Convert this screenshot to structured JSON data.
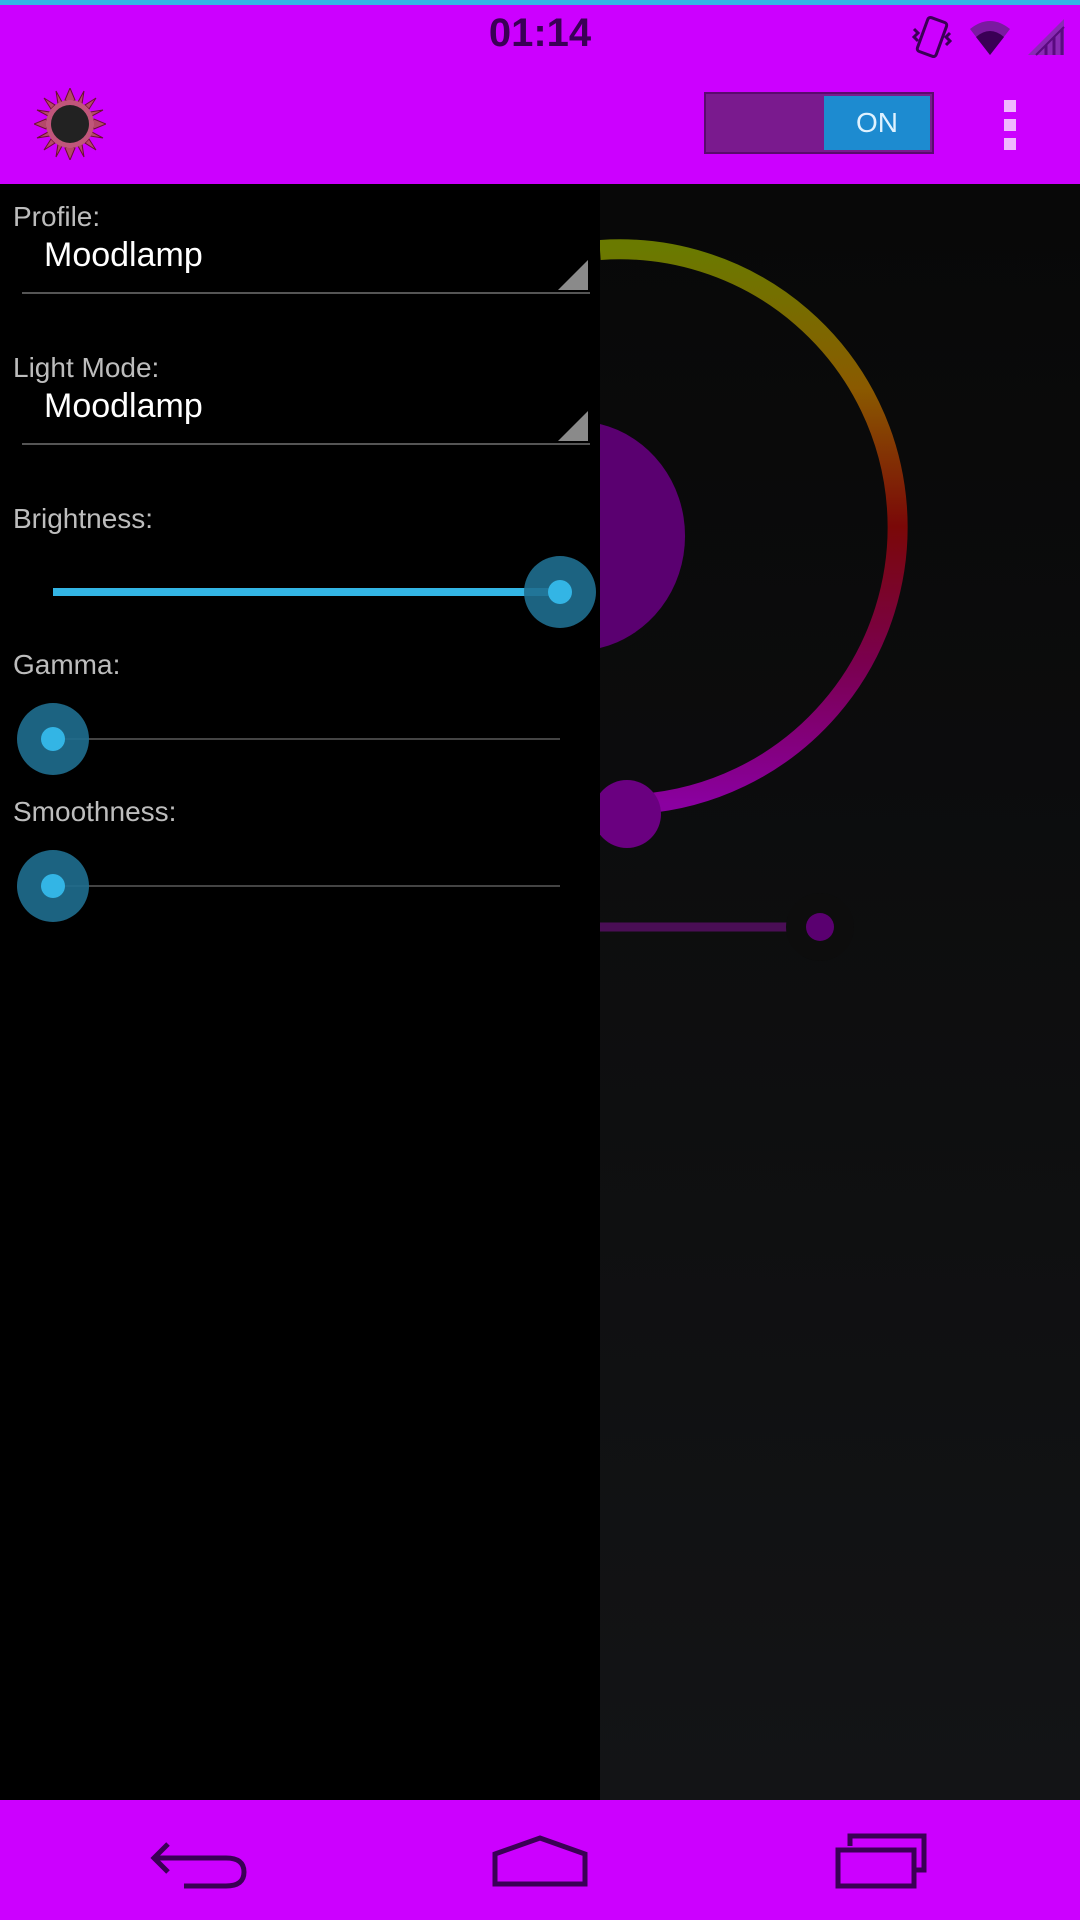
{
  "status_bar": {
    "time": "01:14",
    "icons": [
      "vibrate-icon",
      "wifi-icon",
      "signal-icon"
    ]
  },
  "action_bar": {
    "logo_icon": "sunflower-icon",
    "power_toggle": {
      "label": "ON",
      "state": "on"
    },
    "overflow_icon": "overflow-menu-icon"
  },
  "drawer": {
    "profile": {
      "label": "Profile:",
      "value": "Moodlamp"
    },
    "light_mode": {
      "label": "Light Mode:",
      "value": "Moodlamp"
    },
    "brightness": {
      "label": "Brightness:",
      "value": 1.0
    },
    "gamma": {
      "label": "Gamma:",
      "value": 0.0
    },
    "smoothness": {
      "label": "Smoothness:",
      "value": 0.0
    }
  },
  "nav_bar": {
    "buttons": [
      "back-icon",
      "home-icon",
      "recent-apps-icon"
    ]
  },
  "colors": {
    "primary": "#cc00ff",
    "accent": "#33b5e5",
    "toggle_on": "#1d8bd0",
    "selected_color": "#6a0080"
  }
}
